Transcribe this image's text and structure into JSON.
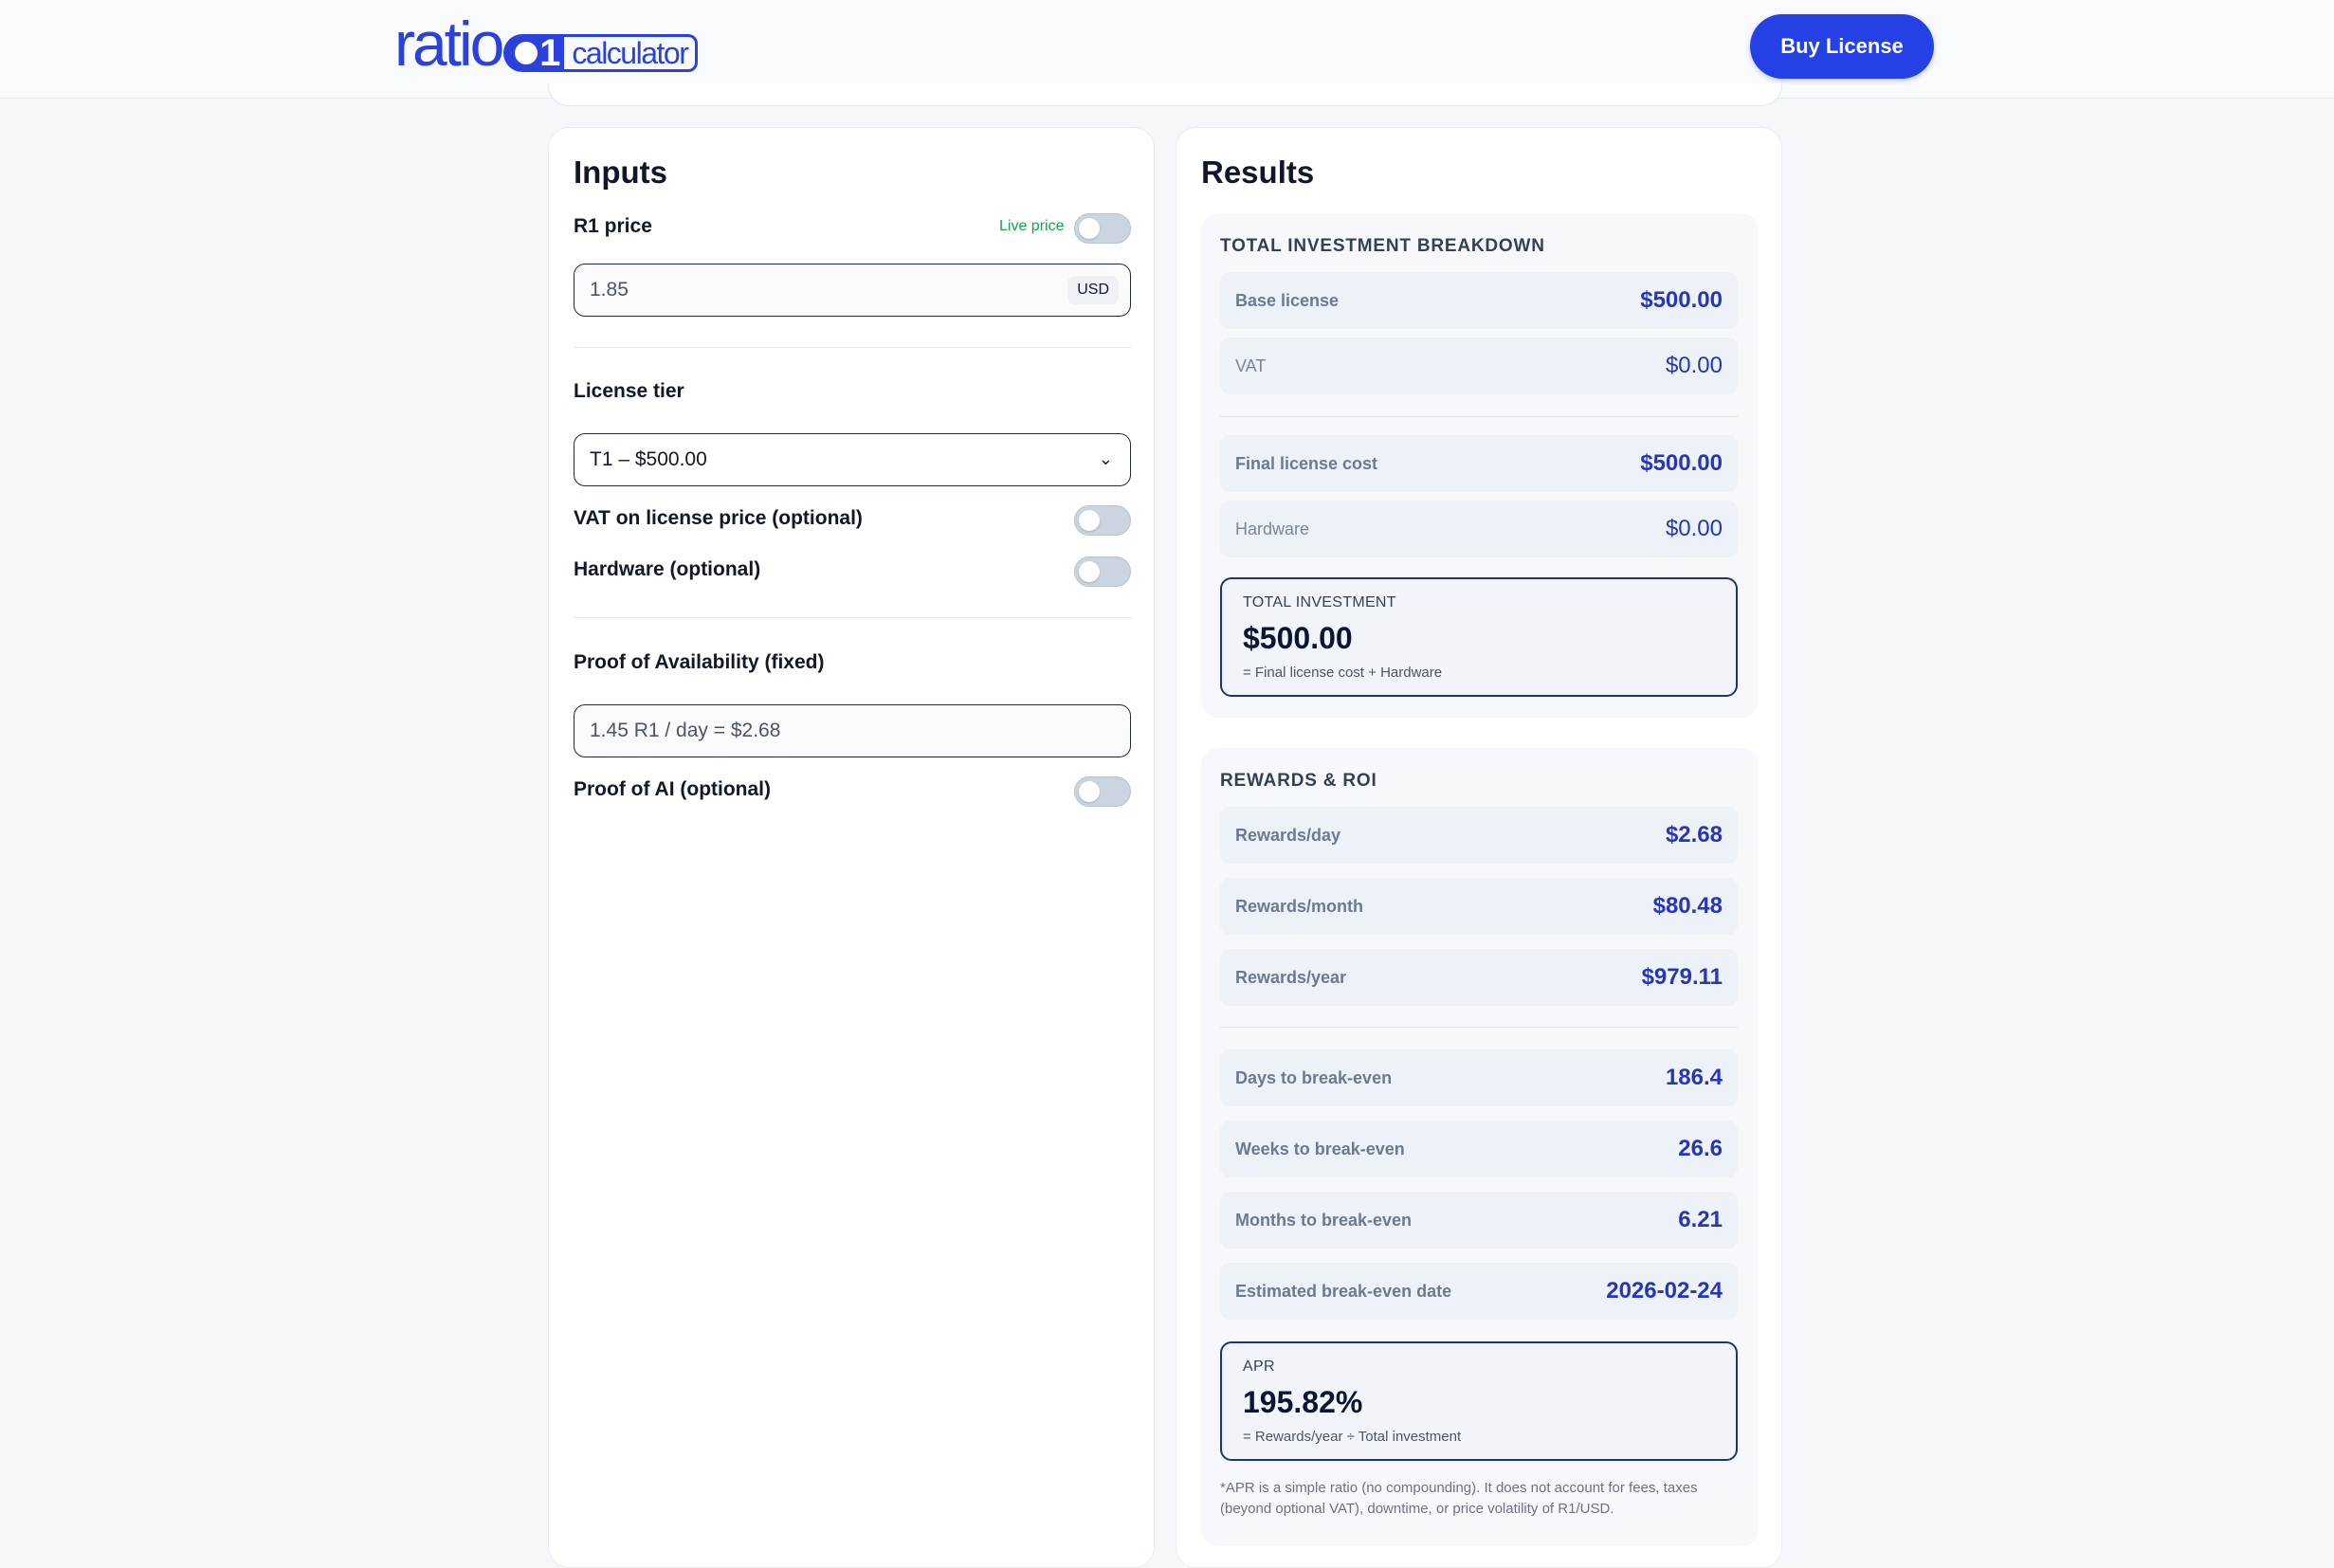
{
  "header": {
    "logo_ratio": "ratio",
    "logo_one": "1",
    "logo_calc": "calculator",
    "buy_label": "Buy License"
  },
  "inputs": {
    "title": "Inputs",
    "r1_price_label": "R1 price",
    "live_price_label": "Live price",
    "r1_price_value": "1.85",
    "r1_price_unit": "USD",
    "license_tier_label": "License tier",
    "license_tier_selected": "T1 – $500.00",
    "vat_label": "VAT on license price (optional)",
    "hardware_label": "Hardware (optional)",
    "poa_label": "Proof of Availability (fixed)",
    "poa_value": "1.45 R1 / day = $2.68",
    "poai_label": "Proof of AI (optional)"
  },
  "results": {
    "title": "Results",
    "investment": {
      "title": "TOTAL INVESTMENT BREAKDOWN",
      "rows": [
        {
          "label": "Base license",
          "value": "$500.00"
        },
        {
          "label": "VAT",
          "value": "$0.00"
        },
        {
          "label": "Final license cost",
          "value": "$500.00"
        },
        {
          "label": "Hardware",
          "value": "$0.00"
        }
      ],
      "total_caption": "TOTAL INVESTMENT",
      "total_value": "$500.00",
      "total_formula": "= Final license cost + Hardware"
    },
    "rewards": {
      "title": "REWARDS & ROI",
      "rows": [
        {
          "label": "Rewards/day",
          "value": "$2.68"
        },
        {
          "label": "Rewards/month",
          "value": "$80.48"
        },
        {
          "label": "Rewards/year",
          "value": "$979.11"
        },
        {
          "label": "Days to break-even",
          "value": "186.4"
        },
        {
          "label": "Weeks to break-even",
          "value": "26.6"
        },
        {
          "label": "Months to break-even",
          "value": "6.21"
        },
        {
          "label": "Estimated break-even date",
          "value": "2026-02-24"
        }
      ],
      "apr_caption": "APR",
      "apr_value": "195.82%",
      "apr_formula": "= Rewards/year ÷ Total investment",
      "footnote": "*APR is a simple ratio (no compounding). It does not account for fees, taxes (beyond optional VAT), downtime, or price volatility of R1/USD."
    }
  },
  "colors": {
    "accent": "#2541e6",
    "value_text": "#2536b8",
    "live_price": "#16a34a"
  }
}
